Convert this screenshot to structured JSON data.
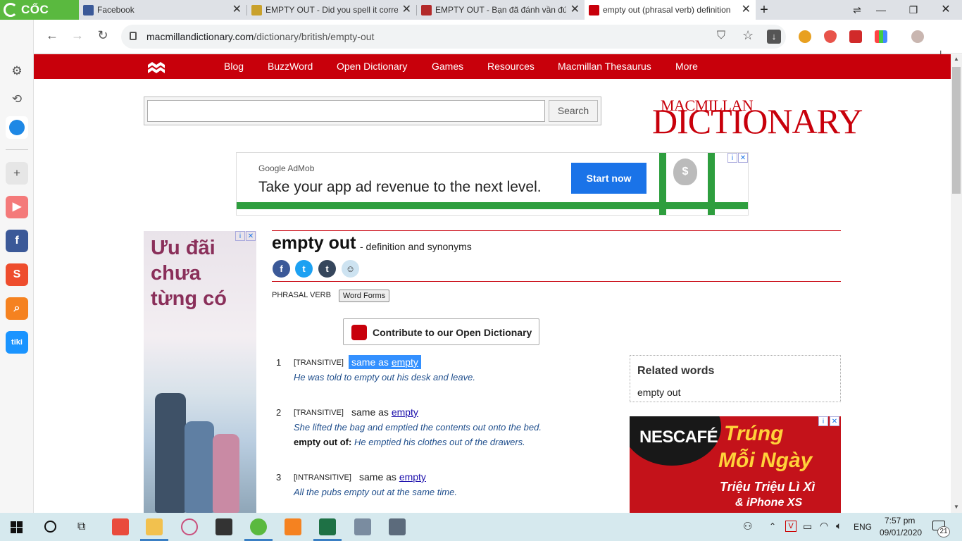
{
  "browser": {
    "brand": "CỐC CỐC",
    "tabs": [
      {
        "title": "Facebook"
      },
      {
        "title": "EMPTY OUT - Did you spell it corre"
      },
      {
        "title": "EMPTY OUT - Bạn đã đánh vần đú"
      },
      {
        "title": "empty out (phrasal verb) definition"
      }
    ],
    "url_host": "macmillandictionary.com",
    "url_path": "/dictionary/british/empty-out"
  },
  "site": {
    "nav": [
      "Blog",
      "BuzzWord",
      "Open Dictionary",
      "Games",
      "Resources",
      "Macmillan Thesaurus",
      "More"
    ],
    "search_button": "Search",
    "logo_top": "MACMILLAN",
    "logo_main": "DICTIONARY"
  },
  "top_ad": {
    "brand": "Google AdMob",
    "headline": "Take your app ad revenue to the next level.",
    "cta": "Start now"
  },
  "side_ad": {
    "line1": "Ưu đãi",
    "line2": "chưa",
    "line3": "từng có"
  },
  "entry": {
    "headword": "empty out",
    "subtitle": "- definition and synonyms",
    "pos": "PHRASAL VERB",
    "word_forms": "Word Forms",
    "contribute": "Contribute to our Open Dictionary",
    "senses": [
      {
        "num": "1",
        "gram": "[TRANSITIVE]",
        "same_as": "same as",
        "link": "empty",
        "example": "He was told to empty out his desk and leave."
      },
      {
        "num": "2",
        "gram": "[TRANSITIVE]",
        "same_as": "same as",
        "link": "empty",
        "example": "She lifted the bag and emptied the contents out onto the bed.",
        "phrase": "empty out of",
        "phrase_example": "He emptied his clothes out of the drawers."
      },
      {
        "num": "3",
        "gram": "[INTRANSITIVE]",
        "same_as": "same as",
        "link": "empty",
        "example": "All the pubs empty out at the same time."
      }
    ]
  },
  "related": {
    "heading": "Related words",
    "items": [
      "empty out"
    ]
  },
  "nescafe_ad": {
    "brand": "NESCAFÉ",
    "line1": "Trúng",
    "line2": "Mỗi Ngày",
    "line3": "Triệu Triệu Lì Xì",
    "line4": "& iPhone XS"
  },
  "taskbar": {
    "lang": "ENG",
    "time": "7:57 pm",
    "date": "09/01/2020",
    "notifications": "21"
  }
}
